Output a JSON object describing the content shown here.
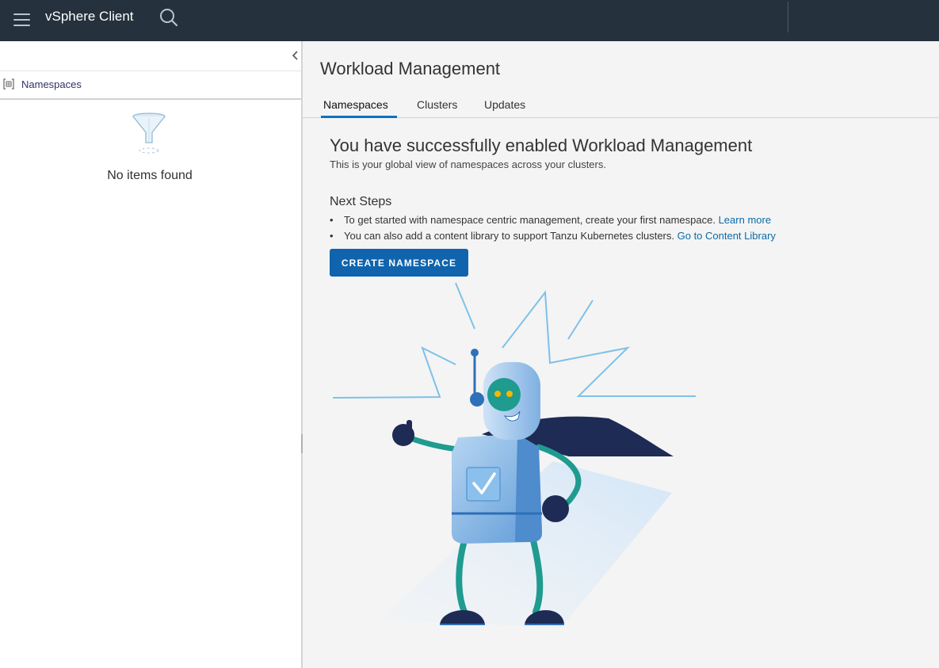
{
  "header": {
    "app_title": "vSphere Client",
    "menu_icon": "hamburger-menu-icon",
    "search_icon": "search-icon",
    "background_color": "#25313d"
  },
  "sidebar": {
    "collapse_icon": "chevron-left-icon",
    "items": [
      {
        "label": "Namespaces",
        "icon": "namespace-icon"
      }
    ],
    "empty_state": {
      "icon": "funnel-filter-icon",
      "text": "No items found"
    }
  },
  "main": {
    "title": "Workload Management",
    "tabs": [
      {
        "label": "Namespaces",
        "active": true
      },
      {
        "label": "Clusters",
        "active": false
      },
      {
        "label": "Updates",
        "active": false
      }
    ],
    "heading": "You have successfully enabled Workload Management",
    "subtitle": "This is your global view of namespaces across your clusters.",
    "next_steps_title": "Next Steps",
    "steps": [
      {
        "text": "To get started with namespace centric management, create your first namespace.",
        "link": "Learn more"
      },
      {
        "text": "You can also add a content library to support Tanzu Kubernetes clusters.",
        "link": "Go to Content Library"
      }
    ],
    "create_button": "CREATE NAMESPACE",
    "illustration": "robot-thumbs-up-illustration"
  },
  "colors": {
    "accent": "#0f64ad",
    "link": "#0c6aa8",
    "tab_underline": "#0f72c0"
  }
}
